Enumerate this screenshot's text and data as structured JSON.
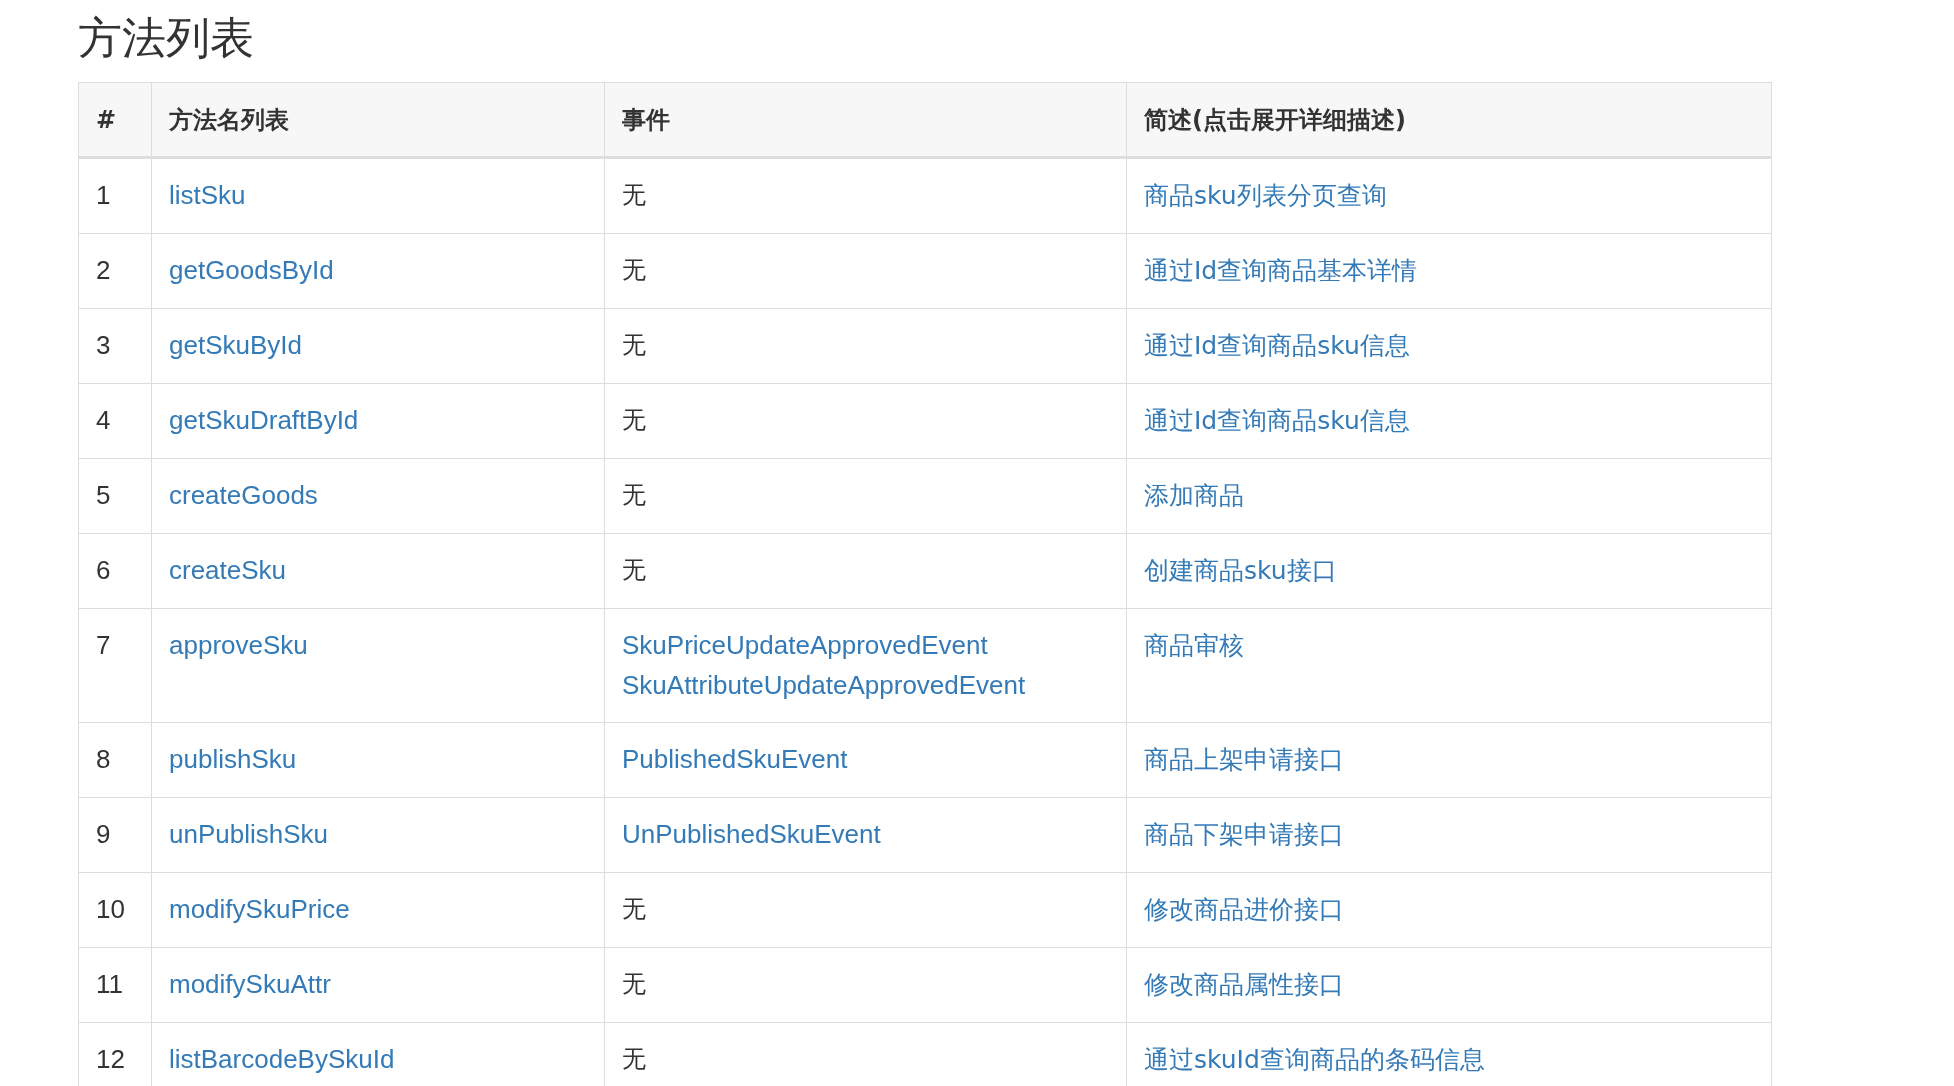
{
  "title": "方法列表",
  "table": {
    "columns": [
      "#",
      "方法名列表",
      "事件",
      "简述(点击展开详细描述)"
    ],
    "rows": [
      {
        "num": "1",
        "method": "listSku",
        "kind": "plain",
        "events": [
          "无"
        ],
        "desc": "商品sku列表分页查询"
      },
      {
        "num": "2",
        "method": "getGoodsById",
        "kind": "plain",
        "events": [
          "无"
        ],
        "desc": "通过Id查询商品基本详情"
      },
      {
        "num": "3",
        "method": "getSkuById",
        "kind": "plain",
        "events": [
          "无"
        ],
        "desc": "通过Id查询商品sku信息"
      },
      {
        "num": "4",
        "method": "getSkuDraftById",
        "kind": "plain",
        "events": [
          "无"
        ],
        "desc": "通过Id查询商品sku信息"
      },
      {
        "num": "5",
        "method": "createGoods",
        "kind": "plain",
        "events": [
          "无"
        ],
        "desc": "添加商品"
      },
      {
        "num": "6",
        "method": "createSku",
        "kind": "plain",
        "events": [
          "无"
        ],
        "desc": "创建商品sku接口"
      },
      {
        "num": "7",
        "method": "approveSku",
        "kind": "link",
        "events": [
          "SkuPriceUpdateApprovedEvent",
          "SkuAttributeUpdateApprovedEvent"
        ],
        "desc": "商品审核"
      },
      {
        "num": "8",
        "method": "publishSku",
        "kind": "link",
        "events": [
          "PublishedSkuEvent"
        ],
        "desc": "商品上架申请接口"
      },
      {
        "num": "9",
        "method": "unPublishSku",
        "kind": "link",
        "events": [
          "UnPublishedSkuEvent"
        ],
        "desc": "商品下架申请接口"
      },
      {
        "num": "10",
        "method": "modifySkuPrice",
        "kind": "plain",
        "events": [
          "无"
        ],
        "desc": "修改商品进价接口"
      },
      {
        "num": "11",
        "method": "modifySkuAttr",
        "kind": "plain",
        "events": [
          "无"
        ],
        "desc": "修改商品属性接口"
      },
      {
        "num": "12",
        "method": "listBarcodeBySkuId",
        "kind": "plain",
        "events": [
          "无"
        ],
        "desc": "通过skuId查询商品的条码信息"
      }
    ]
  }
}
